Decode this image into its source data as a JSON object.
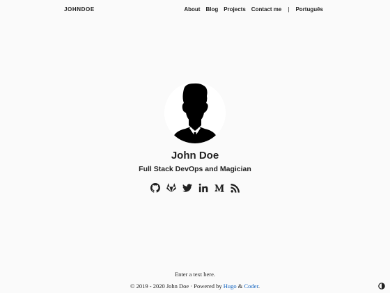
{
  "nav": {
    "brand": "JOHNDOE",
    "items": [
      {
        "label": "About"
      },
      {
        "label": "Blog"
      },
      {
        "label": "Projects"
      },
      {
        "label": "Contact me"
      }
    ],
    "separator": "|",
    "language": "Português"
  },
  "profile": {
    "name": "John Doe",
    "tagline": "Full Stack DevOps and Magician"
  },
  "social": [
    {
      "icon": "github-icon"
    },
    {
      "icon": "gitlab-icon"
    },
    {
      "icon": "twitter-icon"
    },
    {
      "icon": "linkedin-icon"
    },
    {
      "icon": "medium-icon"
    },
    {
      "icon": "rss-icon"
    }
  ],
  "footer": {
    "text": "Enter a text here.",
    "copyright_prefix": "© 2019 - 2020 John Doe · Powered by",
    "hugo_link": "Hugo",
    "amp": "&",
    "coder_link": "Coder",
    "end": "."
  },
  "colors": {
    "background": "#fafafa",
    "text": "#212121",
    "link": "#1565c0"
  }
}
